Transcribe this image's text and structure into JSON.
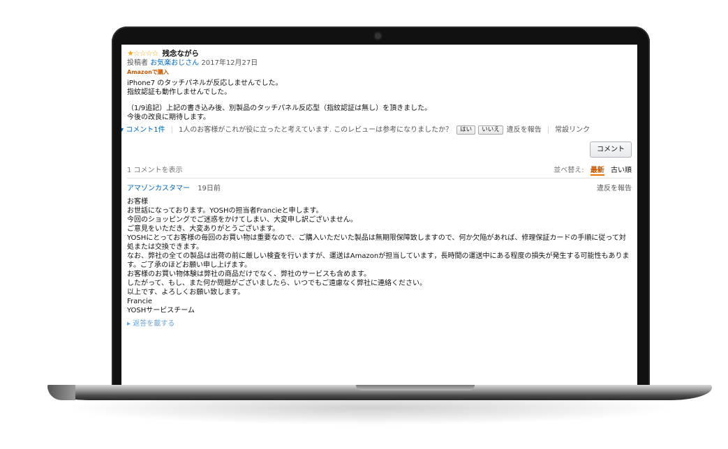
{
  "review": {
    "stars_text": "★☆☆☆☆",
    "title": "残念ながら",
    "posted_by_label": "投稿者",
    "author": "お気楽おじさん",
    "date": "2017年12月27日",
    "purchase_badge": "Amazonで購入",
    "body_lines": [
      "iPhone7 のタッチパネルが反応しませんでした。",
      "指紋認証も動作しませんでした。",
      "",
      "（1/9追記）上記の書き込み後、別製品のタッチパネル反応型（指紋認証は無し）を頂きました。",
      "今後の改良に期待します。"
    ]
  },
  "actions": {
    "comments_toggle": "▾ コメント1件",
    "helpful_text": "1人のお客様がこれが役に立ったと考えています. このレビューは参考になりましたか？",
    "yes_label": "はい",
    "no_label": "いいえ",
    "report_label": "違反を報告",
    "permalink_label": "常設リンク"
  },
  "comment_button_label": "コメント",
  "comments_section": {
    "show_label": "1 コメントを表示",
    "sort_label": "並べ替え:",
    "sort_newest": "最新",
    "sort_oldest": "古い順"
  },
  "comment": {
    "author": "アマゾンカスタマー",
    "age": "19日前",
    "report_label": "違反を報告",
    "lines": [
      "お客様",
      "お世話になっております。YOSHの担当者Francieと申します。",
      "今回のショッピングでご迷惑をかけてしまい、大変申し訳ございません。",
      "ご意見をいただき、大変ありがとうございます。",
      "YOSHにとってお客様の毎回のお買い物は重要なので、ご購入いただいた製品は無期限保障致しますので、何か欠陥があれば、修理保証カードの手順に従って対処または交換できます。",
      "なお、弊社の全ての製品は出荷の前に厳しい検査を行いますが、運送はAmazonが担当しています，長時間の運送中にある程度の損失が発生する可能性もあります。ご了承のほどお願い申し上げます。",
      "お客様のお買い物体験は弊社の商品だけでなく、弊社のサービスも含めます。",
      "したがって、もし、また何か問題がございましたら、いつでもご遠慮なく弊社に連絡ください。",
      "以上です、よろしくお願い致します。",
      "Francie",
      "YOSHサービスチーム"
    ],
    "reply_label": "▸ 返答を載する"
  }
}
